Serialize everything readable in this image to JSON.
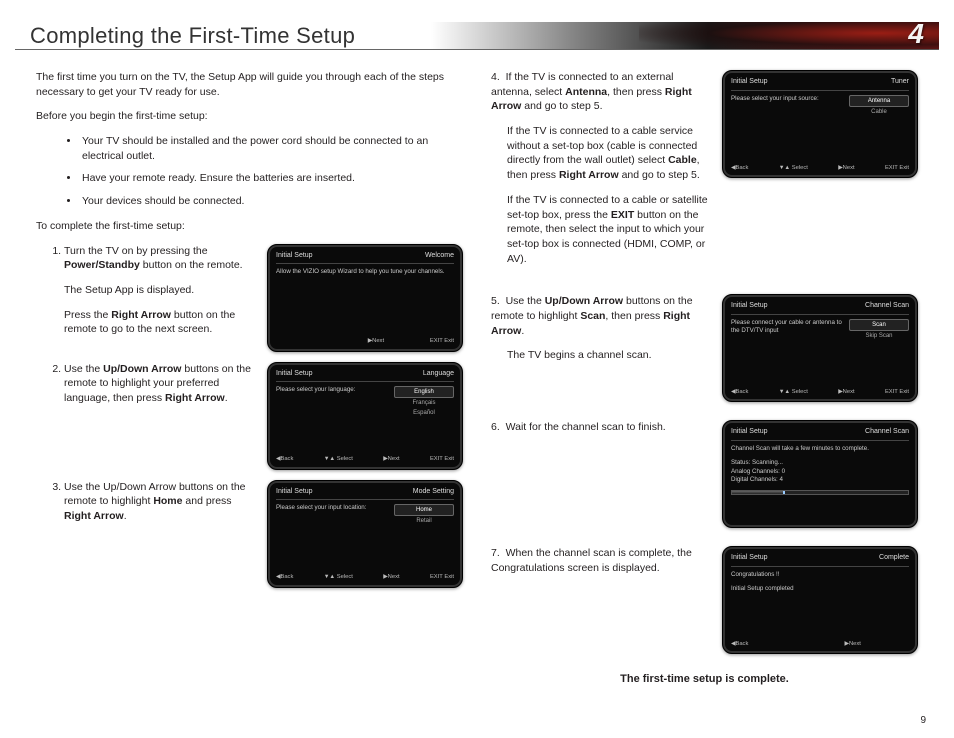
{
  "header": {
    "title": "Completing the First-Time Setup",
    "chapter": "4"
  },
  "intro": {
    "p1": "The first time you turn on the TV, the Setup App will guide you through each of the steps necessary to get your TV ready for use.",
    "p2": "Before you begin the first-time setup:",
    "bullets": [
      "Your TV should be installed and the power cord should be connected to an electrical outlet.",
      "Have your remote ready. Ensure the batteries are inserted.",
      "Your devices should be connected."
    ],
    "p3": "To complete the first-time setup:"
  },
  "steps_left": [
    {
      "parts": [
        {
          "pre": "Turn the TV on by pressing the ",
          "bold": "Power/Standby",
          "post": " button on the remote."
        },
        {
          "plain": "The Setup App is displayed."
        },
        {
          "pre": "Press the ",
          "bold": "Right Arrow",
          "post": " button on the remote to go to the next screen."
        }
      ],
      "screen": {
        "title": "Initial Setup",
        "sub": "Welcome",
        "body": "Allow the VIZIO setup Wizard to help you tune your channels.",
        "footer": [
          "",
          "",
          "▶Next",
          "EXIT Exit"
        ]
      }
    },
    {
      "parts": [
        {
          "pre": "Use the ",
          "bold": "Up/Down Arrow",
          "post": " buttons on the remote to highlight your preferred language, then press ",
          "bold2": "Right Arrow",
          "post2": "."
        }
      ],
      "screen": {
        "title": "Initial Setup",
        "sub": "Language",
        "prompt": "Please select your language:",
        "options": [
          "English",
          "Français",
          "Español"
        ],
        "selected": 0,
        "footer": [
          "◀Back",
          "▼▲ Select",
          "▶Next",
          "EXIT Exit"
        ]
      }
    },
    {
      "parts": [
        {
          "pre": "Use the Up/Down Arrow buttons on the remote to highlight ",
          "bold": "Home",
          "post": " and press ",
          "bold2": "Right Arrow",
          "post2": "."
        }
      ],
      "screen": {
        "title": "Initial Setup",
        "sub": "Mode Setting",
        "prompt": "Please select your input location:",
        "options": [
          "Home",
          "Retail"
        ],
        "selected": 0,
        "footer": [
          "◀Back",
          "▼▲ Select",
          "▶Next",
          "EXIT Exit"
        ]
      }
    }
  ],
  "steps_right": [
    {
      "num": "4",
      "paras": [
        {
          "pre": "If the TV is connected to an external antenna, select ",
          "bold": "Antenna",
          "post": ", then press ",
          "bold2": "Right Arrow",
          "post2": " and go to step 5."
        },
        {
          "pre": "If the TV is connected to a cable service without a set-top box (cable is connected directly from the wall outlet) select ",
          "bold": "Cable",
          "post": ", then press ",
          "bold2": "Right Arrow",
          "post2": " and go to step 5."
        },
        {
          "pre": "If the TV is connected to a cable or satellite set-top box, press the ",
          "bold": "EXIT",
          "post": " button on the remote, then select the input to which your set-top box is connected (HDMI, COMP, or AV)."
        }
      ],
      "screen": {
        "title": "Initial Setup",
        "sub": "Tuner",
        "prompt": "Please select your input source:",
        "options": [
          "Antenna",
          "Cable"
        ],
        "selected": 0,
        "footer": [
          "◀Back",
          "▼▲ Select",
          "▶Next",
          "EXIT Exit"
        ]
      }
    },
    {
      "num": "5",
      "paras": [
        {
          "pre": "Use the ",
          "bold": "Up/Down Arrow",
          "post": " buttons on the remote to highlight ",
          "bold2": "Scan",
          "post2": ", then press ",
          "bold3": "Right Arrow",
          "post3": "."
        },
        {
          "plain": "The TV begins a channel scan."
        }
      ],
      "screen": {
        "title": "Initial Setup",
        "sub": "Channel Scan",
        "prompt": "Please connect your cable or antenna to the DTV/TV input",
        "options": [
          "Scan",
          "Skip Scan"
        ],
        "selected": 0,
        "footer": [
          "◀Back",
          "▼▲ Select",
          "▶Next",
          "EXIT Exit"
        ]
      }
    },
    {
      "num": "6",
      "paras": [
        {
          "plain": "Wait for the channel scan to finish."
        }
      ],
      "screen": {
        "title": "Initial Setup",
        "sub": "Channel Scan",
        "body": "Channel Scan will take a few minutes to complete.",
        "status": [
          "Status: Scanning...",
          "Analog Channels: 0",
          "Digital Channels: 4"
        ],
        "progress": true,
        "footer": [
          "",
          "",
          "",
          ""
        ]
      }
    },
    {
      "num": "7",
      "paras": [
        {
          "plain": "When the channel scan is complete, the Congratulations screen is displayed."
        }
      ],
      "screen": {
        "title": "Initial Setup",
        "sub": "Complete",
        "body": "Congratulations !!",
        "body2": "Initial Setup completed",
        "footer": [
          "◀Back",
          "",
          "▶Next",
          ""
        ]
      }
    }
  ],
  "complete": "The first-time setup is complete.",
  "pagenum": "9"
}
